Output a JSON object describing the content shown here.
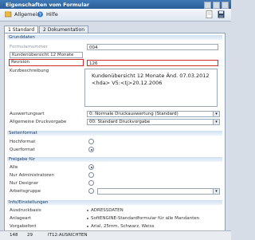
{
  "window": {
    "title": "Eigenschaften vom Formular"
  },
  "menu": {
    "general": "Allgemein",
    "help": "Hilfe"
  },
  "tabs": [
    "1 Standard",
    "2 Dokumentation"
  ],
  "grunddaten": {
    "header": "Grunddaten",
    "formularnummer_label": "Formularnummer",
    "formularnummer_value": "004",
    "bezeichnung_label": "Kundenübersicht 12 Monate",
    "revision_label": "Revision",
    "revision_value": "126",
    "kurzbeschreibung_label": "Kurzbeschreibung",
    "description_line1": "Kundenübersicht 12 Monate   Änd. 07.03.2012",
    "description_line2": "<hda>   V5:<tj>20.12.2006",
    "auswertungsart_label": "Auswertungsart",
    "auswertungsart_value": "0: Normale Druckauswertung (Standard)",
    "druckvorgabe_label": "Allgemeine Druckvorgabe",
    "druckvorgabe_value": "00: Standard Druckvorgabe"
  },
  "seitenformat": {
    "header": "Seitenformat",
    "hochformat": "Hochformat",
    "querformat": "Querformat"
  },
  "freigabe": {
    "header": "Freigabe für",
    "alle": "Alle",
    "admins": "Nur Administratoren",
    "designer": "Nur Designer",
    "arbeitsgruppe": "Arbeitsgruppe"
  },
  "info": {
    "header": "Info/Einstellungen",
    "ausdruckbasis_label": "Ausdruckbasis",
    "ausdruckbasis_value": "ADRESSDATEN",
    "anlageart_label": "Anlageart",
    "anlageart_value": "SoftENGINE-Standardformular für alle Mandanten",
    "vorgabefont_label": "Vorgabefont",
    "vorgabefont_value": "Arial, 25mm, Schwarz, Weiss"
  },
  "statusbar": {
    "c1": "148",
    "c2": "29",
    "c3": "IT12:AUSRICHTEN"
  }
}
